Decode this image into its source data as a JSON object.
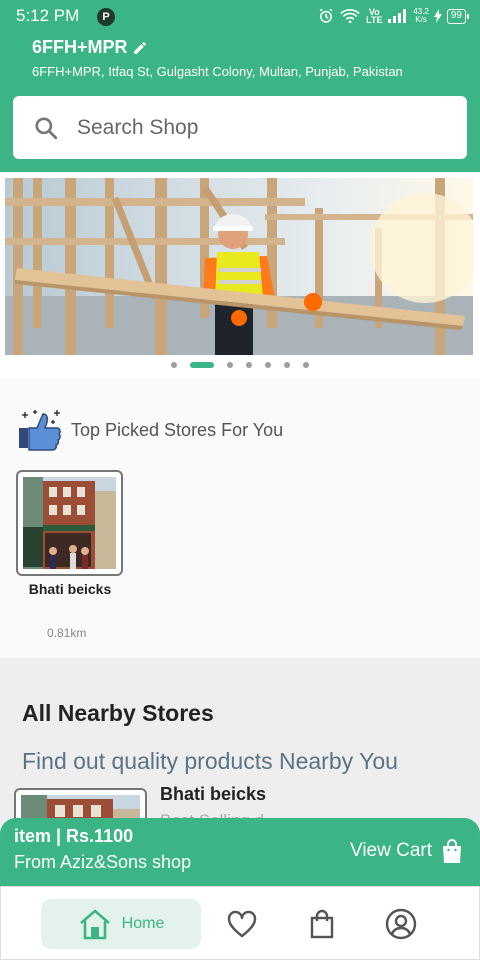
{
  "status": {
    "time": "5:12 PM",
    "app_icon": "P",
    "network": "Vo LTE",
    "speed_value": "43.2",
    "speed_unit": "K/s",
    "battery": "99"
  },
  "location": {
    "title": "6FFH+MPR",
    "address": "6FFH+MPR, Itfaq St, Gulgasht Colony, Multan, Punjab, Pakistan"
  },
  "search": {
    "placeholder": "Search Shop"
  },
  "banner": {
    "dots": 7,
    "active_index": 1
  },
  "top_picked": {
    "title": "Top Picked Stores For You",
    "stores": [
      {
        "name": "Bhati beicks",
        "distance": "0.81km"
      }
    ]
  },
  "nearby": {
    "title": "All Nearby Stores",
    "subtitle": "Find out quality products Nearby You",
    "store_name": "Bhati beicks",
    "store_sub": "Best Selling d..."
  },
  "cart": {
    "item": "item | Rs.1100",
    "shop": "From Aziz&Sons shop",
    "action": "View Cart"
  },
  "nav": {
    "home": "Home"
  },
  "colors": {
    "primary": "#3bb585",
    "subtitle": "#5a7386"
  }
}
